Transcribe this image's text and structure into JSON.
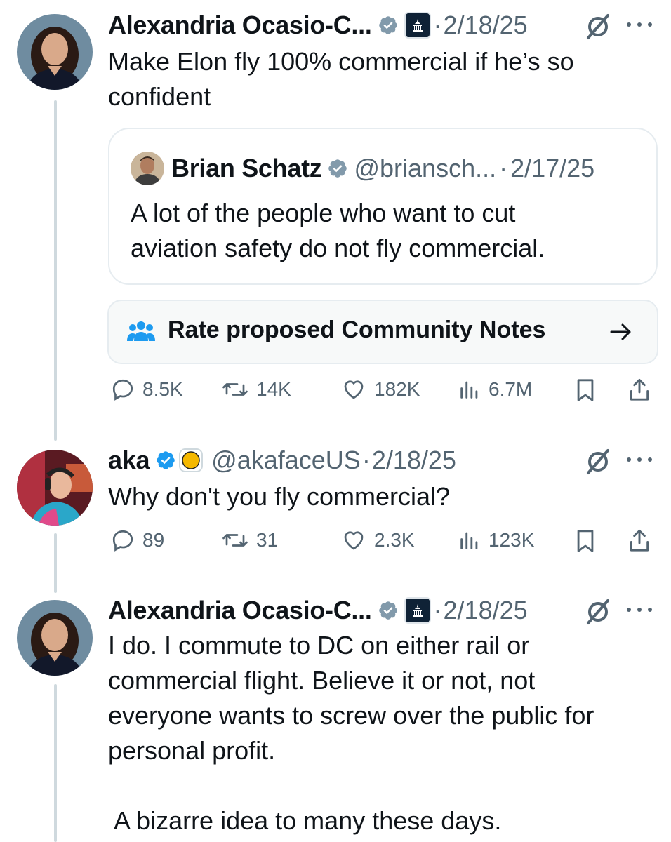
{
  "tweet1": {
    "name": "Alexandria Ocasio-C...",
    "date": "2/18/25",
    "text_line1": "Make Elon fly 100% commercial if he’s so",
    "text_line2": "confident",
    "quote": {
      "name": "Brian Schatz",
      "handle": "@briansch...",
      "date": "2/17/25",
      "text_line1": "A lot of the people who want to cut",
      "text_line2": "aviation safety do not fly commercial."
    },
    "community_notes_label": "Rate proposed Community Notes",
    "stats": {
      "replies": "8.5K",
      "reposts": "14K",
      "likes": "182K",
      "views": "6.7M"
    }
  },
  "tweet2": {
    "name": "aka",
    "handle": "@akafaceUS",
    "date": "2/18/25",
    "text": "Why don't you fly commercial?",
    "stats": {
      "replies": "89",
      "reposts": "31",
      "likes": "2.3K",
      "views": "123K"
    }
  },
  "tweet3": {
    "name": "Alexandria Ocasio-C...",
    "date": "2/18/25",
    "text_line1": "I do. I commute to DC on either rail or",
    "text_line2": "commercial flight. Believe it or not, not",
    "text_line3": "everyone wants to screw over the public for",
    "text_line4": "personal profit.",
    "text_line5": " A bizarre idea to many these days."
  },
  "separator": "·",
  "colors": {
    "verified": "#1d9bf0",
    "muted": "#536471",
    "text": "#0f1419",
    "border": "#e6ecf0",
    "note_icon": "#1d9bf0"
  },
  "icons": [
    "verified-badge-icon",
    "government-badge-icon",
    "grok-icon",
    "more-icon",
    "reply-icon",
    "repost-icon",
    "like-icon",
    "views-icon",
    "bookmark-icon",
    "share-icon",
    "community-notes-icon",
    "arrow-right-icon"
  ]
}
